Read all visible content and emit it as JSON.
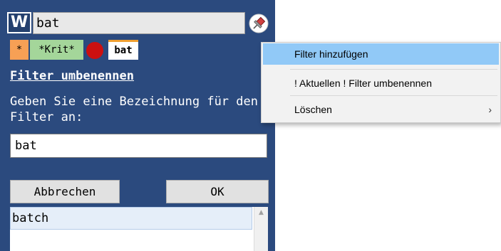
{
  "header": {
    "logo_letter": "W",
    "search_value": "bat",
    "pin_icon": "pin-icon"
  },
  "tabs": [
    {
      "label": "*",
      "color": "#f7a055"
    },
    {
      "label": "*Krit*",
      "color": "#a4d69a"
    },
    {
      "label": "",
      "color": "#cc1010",
      "icon": "red-dot-icon"
    },
    {
      "label": "bat",
      "color": "#ffffff",
      "active": true
    }
  ],
  "dialog": {
    "title": "Filter umbenennen",
    "description": "Geben Sie eine Bezeichnung für den Filter an:",
    "input_value": "bat",
    "cancel_label": "Abbrechen",
    "ok_label": "OK"
  },
  "list": {
    "items": [
      "batch"
    ]
  },
  "context_menu": {
    "items": [
      {
        "label": "Filter hinzufügen",
        "highlighted": true
      },
      {
        "label": "! Aktuellen ! Filter umbenennen"
      },
      {
        "label": "Löschen",
        "submenu_arrow": "›"
      }
    ]
  },
  "colors": {
    "panel_bg": "#2b4a7e",
    "menu_highlight": "#91c9f7"
  }
}
